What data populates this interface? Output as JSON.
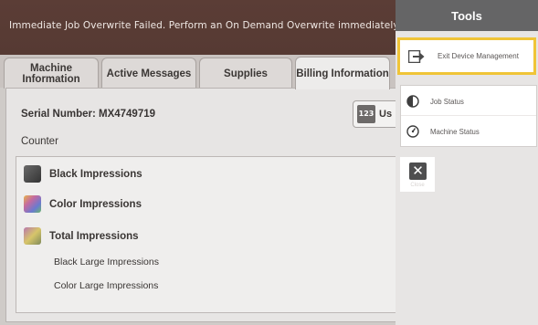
{
  "banner": {
    "message": "Immediate Job Overwrite Failed.  Perform an On Demand Overwrite immediately."
  },
  "tabs": [
    {
      "label": "Machine Information"
    },
    {
      "label": "Active Messages"
    },
    {
      "label": "Supplies"
    },
    {
      "label": "Billing Information"
    }
  ],
  "billing": {
    "serial": "Serial Number: MX4749719",
    "units_icon_text": "123",
    "units_label": "Us",
    "counter_label": "Counter",
    "rows": [
      {
        "label": "Black Impressions",
        "color": "#4a4a4a"
      },
      {
        "label": "Color Impressions",
        "color": "#b06aa4"
      },
      {
        "label": "Total Impressions",
        "color": "#a8a36a"
      }
    ],
    "sub_rows": [
      {
        "label": "Black Large Impressions"
      },
      {
        "label": "Color Large Impressions"
      }
    ]
  },
  "tools": {
    "title": "Tools",
    "exit_label": "Exit Device Management",
    "job_status_label": "Job Status",
    "machine_status_label": "Machine Status",
    "close_label": "Close",
    "highlight_color": "#f0c437"
  }
}
